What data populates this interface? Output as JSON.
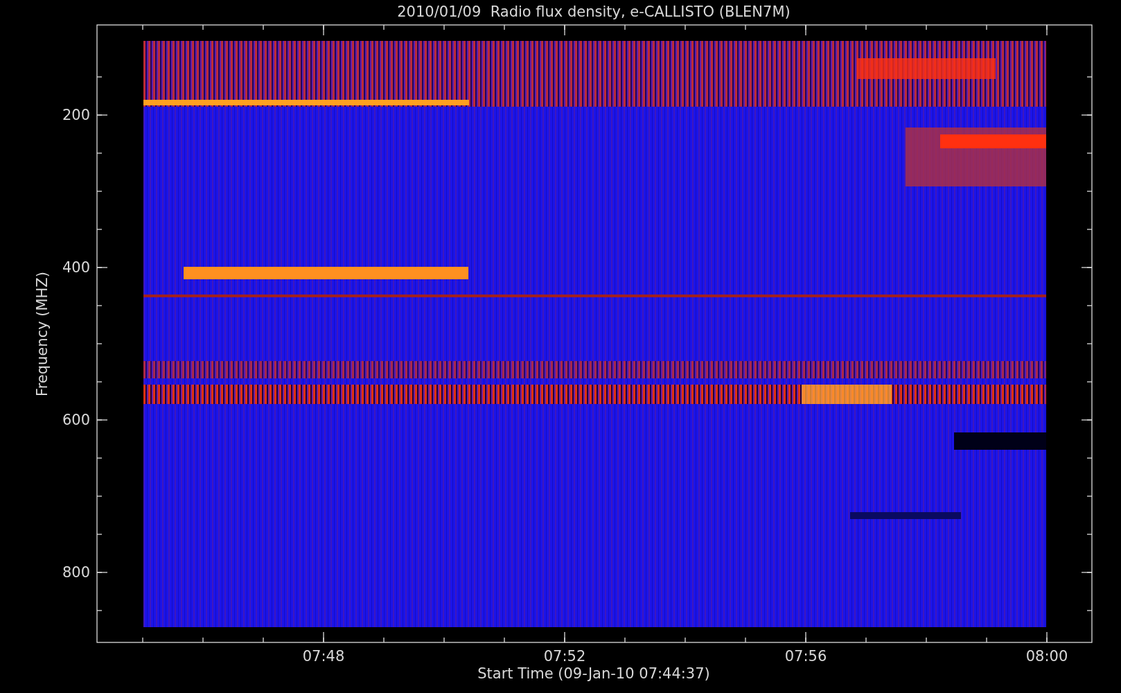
{
  "title": "2010/01/09  Radio flux density, e-CALLISTO (BLEN7M)",
  "y_axis": {
    "label": "Frequency (MHZ)",
    "ticks": [
      "200",
      "400",
      "600",
      "800"
    ]
  },
  "x_axis": {
    "label": "Start Time (09-Jan-10 07:44:37)",
    "ticks": [
      "07:48",
      "07:52",
      "07:56",
      "08:00"
    ]
  }
}
